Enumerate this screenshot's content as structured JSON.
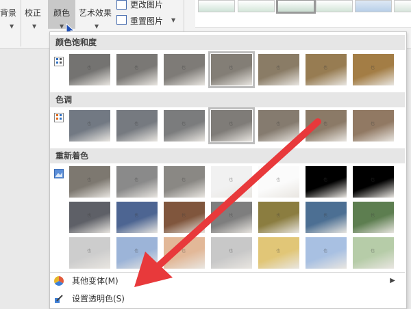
{
  "ribbon": {
    "partial_label": "背景",
    "correct_label": "校正",
    "color_label": "颜色",
    "art_effects_label": "艺术效果",
    "change_picture_label": "更改图片",
    "reset_picture_label": "重置图片"
  },
  "panel": {
    "saturation": {
      "header": "颜色饱和度",
      "tiles": [
        "#747371",
        "#7a7875",
        "#7e7b77",
        "#837e76",
        "#8a7c66",
        "#977c52",
        "#a37d45"
      ],
      "selected_index": 3
    },
    "tone": {
      "header": "色调",
      "tiles": [
        "#727983",
        "#767a80",
        "#7b7c7d",
        "#7f7c78",
        "#857b6f",
        "#8b7a67",
        "#917963"
      ],
      "selected_index": 3
    },
    "recolor": {
      "header": "重新着色",
      "rows": [
        [
          "#7d7870",
          "#8a8a8a",
          "#8a8884",
          "#f1f1f1",
          "#fbfbfb",
          "#000000",
          "#000000"
        ],
        [
          "#5e6067",
          "#4d6592",
          "#80563d",
          "#7e7e7e",
          "#8b7d40",
          "#4c6f93",
          "#5d7e50"
        ],
        [
          "#cdcdcd",
          "#9cb4d8",
          "#e2b898",
          "#c8c8c8",
          "#e1c677",
          "#a8c0e2",
          "#b6cca8"
        ]
      ]
    },
    "menu": {
      "more_variants": "其他变体(M)",
      "set_transparent": "设置透明色(S)"
    }
  },
  "colors": {
    "arrow": "#e8393b",
    "section_bg": "#e6e6e6",
    "ribbon_bg": "#f3f3f3"
  }
}
